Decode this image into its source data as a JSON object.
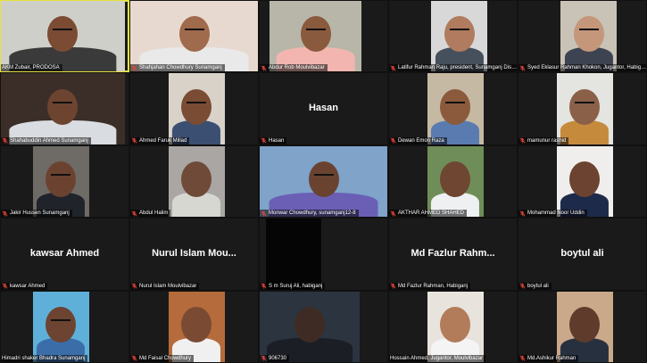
{
  "colors": {
    "background": "#1a1a1a",
    "active_speaker_border": "#e6e23a",
    "muted_icon": "#e0443a"
  },
  "participants": [
    {
      "name": "AKM Zubair, PRODOSA",
      "video": true,
      "bg": "#cfcfc9",
      "skin": "#7b4b34",
      "shirt": "#3a3a3a",
      "glasses": true,
      "active": true
    },
    {
      "name": "Shahjahan Chowdhury Sunamganj",
      "video": true,
      "bg": "#e8d9d0",
      "skin": "#a06a4c",
      "shirt": "#e9e9e9",
      "glasses": true,
      "muted": true
    },
    {
      "name": "Abdur Rob Moulvibazar",
      "video": true,
      "bg": "#b7b6a8",
      "skin": "#8a5a3e",
      "shirt": "#f2b5b0",
      "glasses": true,
      "muted": true
    },
    {
      "name": "Latifur Rahman Raju, president, Sunamganj District",
      "video": true,
      "bg": "#d8d8d8",
      "skin": "#b07b5e",
      "shirt": "#45505c",
      "glasses": true,
      "muted": true
    },
    {
      "name": "Syed Eklasur Rahman Khokon, Jugantor, Habiganj",
      "video": true,
      "bg": "#c9c2b6",
      "skin": "#c4977a",
      "shirt": "#3e4352",
      "glasses": true,
      "muted": true
    },
    {
      "name": "Shahabuddin Ahmed Sunamganj",
      "video": true,
      "bg": "#3b2e28",
      "skin": "#6d4430",
      "shirt": "#d9dce0",
      "glasses": true,
      "muted": true
    },
    {
      "name": "Ahmed Faruk Millad",
      "video": true,
      "bg": "#d9d2c8",
      "skin": "#7a4c34",
      "shirt": "#3a4f72",
      "glasses": true,
      "muted": true
    },
    {
      "name": "Hasan",
      "video": false,
      "display": "Hasan",
      "muted": true
    },
    {
      "name": "Dewan Emon Raza",
      "video": true,
      "bg": "#c6b9a4",
      "skin": "#8b5a3d",
      "shirt": "#5a7bb0",
      "glasses": true,
      "muted": true
    },
    {
      "name": "mamunur rashid",
      "video": true,
      "bg": "#e4e4e0",
      "skin": "#8a6048",
      "shirt": "#c58a3c",
      "glasses": true,
      "muted": true
    },
    {
      "name": "Jakir Hussen Sunamganj",
      "video": true,
      "bg": "#6e6a66",
      "skin": "#6b4230",
      "shirt": "#20232a",
      "glasses": true,
      "muted": true
    },
    {
      "name": "Abdul Halim",
      "video": true,
      "bg": "#a9a6a4",
      "skin": "#6f4a38",
      "shirt": "#d7d7d2",
      "glasses": false,
      "muted": true
    },
    {
      "name": "Monwar Chowdhury, sunamganj12-8",
      "video": true,
      "bg": "#7fa3c9",
      "skin": "#6a4330",
      "shirt": "#6a5fb5",
      "glasses": true,
      "muted": true
    },
    {
      "name": "AKTHAR AHMED SHAHED",
      "video": true,
      "bg": "#6f8d58",
      "skin": "#6e4632",
      "shirt": "#eef0f2",
      "glasses": false,
      "muted": true
    },
    {
      "name": "Mohammad Noor Uddin",
      "video": true,
      "bg": "#f0eeec",
      "skin": "#6b4330",
      "shirt": "#1e2a4a",
      "glasses": false,
      "muted": true
    },
    {
      "name": "kawsar Ahmed",
      "video": false,
      "display": "kawsar Ahmed",
      "muted": true
    },
    {
      "name": "Nurul Islam Moulvibazar",
      "video": false,
      "display": "Nurul Islam Mou...",
      "muted": true
    },
    {
      "name": "S m Suruj Ali, habiganj",
      "video": true,
      "bg": "#050505",
      "skin": "#050505",
      "shirt": "#050505",
      "glasses": false,
      "dark": true,
      "muted": true
    },
    {
      "name": "Md Fazlur Rahman, Habiganj",
      "video": false,
      "display": "Md Fazlur Rahm...",
      "muted": true
    },
    {
      "name": "boytul ali",
      "video": false,
      "display": "boytul ali",
      "muted": true
    },
    {
      "name": "Himadri shaker Bhadra Sunamganj",
      "video": true,
      "bg": "#5fb0d8",
      "skin": "#6c4431",
      "shirt": "#3b6ea8",
      "glasses": true,
      "muted": false
    },
    {
      "name": "Md Faisal Chowdhury",
      "video": true,
      "bg": "#b56b3b",
      "skin": "#7a4a33",
      "shirt": "#f0f0f0",
      "glasses": false,
      "muted": true
    },
    {
      "name": "906730",
      "video": true,
      "bg": "#2c3440",
      "skin": "#3e2c24",
      "shirt": "#1b1e24",
      "glasses": false,
      "muted": true
    },
    {
      "name": "Hossain Ahmed, Jugantor, Moulvibazar",
      "video": true,
      "bg": "#e8e3dc",
      "skin": "#b27b5a",
      "shirt": "#f4f4f4",
      "glasses": false,
      "muted": false
    },
    {
      "name": "Md.Ashikur Rahman",
      "video": true,
      "bg": "#caa88a",
      "skin": "#5e3b2b",
      "shirt": "#27303f",
      "glasses": false,
      "muted": true
    }
  ]
}
